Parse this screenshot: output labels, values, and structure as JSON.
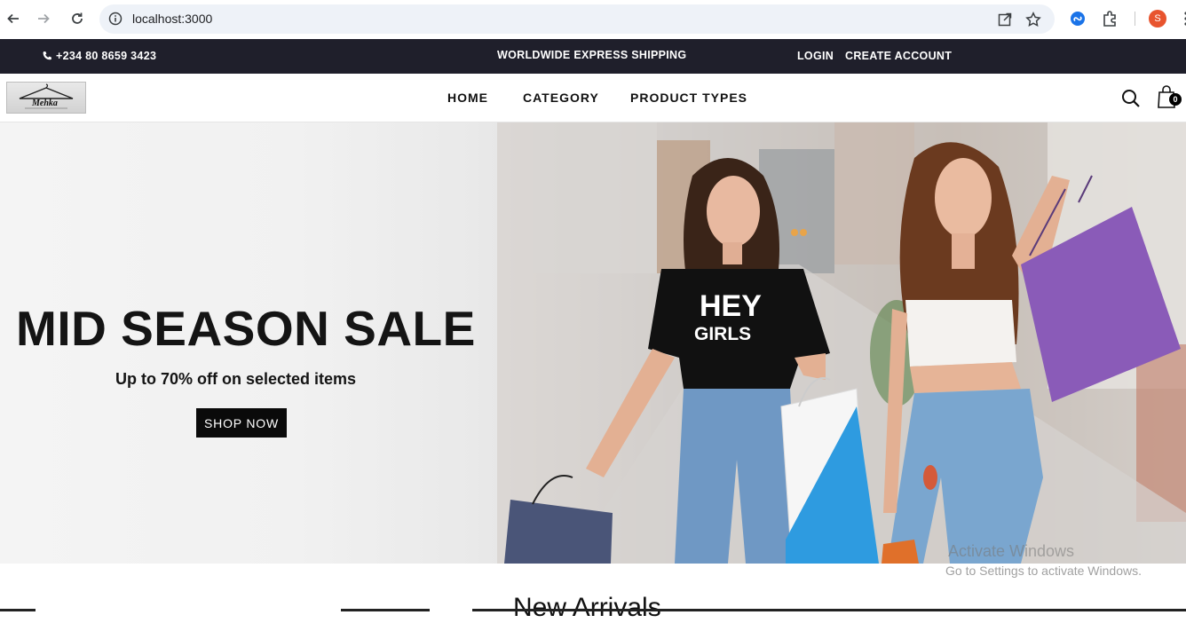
{
  "browser": {
    "url": "localhost:3000",
    "profile_initial": "S"
  },
  "topbar": {
    "phone": "+234 80 8659 3423",
    "shipping": "WORLDWIDE EXPRESS SHIPPING",
    "login": "LOGIN",
    "create_account": "CREATE ACCOUNT"
  },
  "nav": {
    "items": [
      {
        "label": "HOME"
      },
      {
        "label": "CATEGORY"
      },
      {
        "label": "PRODUCT TYPES"
      }
    ],
    "cart_count": "0",
    "logo_text": "Mehka"
  },
  "hero": {
    "title": "MID SEASON SALE",
    "subtitle": "Up to 70% off on selected items",
    "cta": "SHOP NOW",
    "shirt_text_1": "HEY",
    "shirt_text_2": "GIRLS"
  },
  "section": {
    "title": "New Arrivals"
  },
  "watermark": {
    "line1": "Activate Windows",
    "line2": "Go to Settings to activate Windows."
  },
  "colors": {
    "topbar_bg": "#1f1f2b",
    "button_bg": "#0a0a0a",
    "accent_bag": "#8a5bb8"
  }
}
